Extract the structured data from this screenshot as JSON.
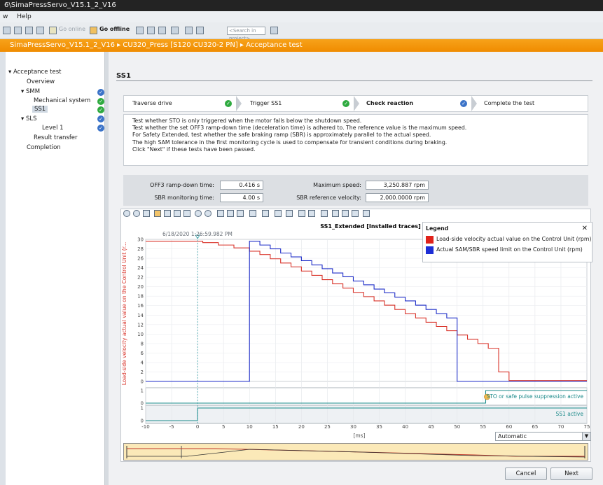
{
  "window": {
    "title": "6\\SimaPressServo_V15.1_2_V16"
  },
  "menu": {
    "items": [
      "w",
      "Help"
    ]
  },
  "toolbar": {
    "go_online": "Go online",
    "go_offline": "Go offline",
    "search_placeholder": "<Search in project>"
  },
  "breadcrumb": {
    "text": "SimaPressServo_V15.1_2_V16 ▸ CU320_Press [S120 CU320-2 PN] ▸ Acceptance test"
  },
  "tree": {
    "items": [
      {
        "label": "▾ Acceptance test",
        "check": ""
      },
      {
        "label": "Overview",
        "check": ""
      },
      {
        "label": "▾ SMM",
        "check": "blue"
      },
      {
        "label": "Mechanical system",
        "check": "green"
      },
      {
        "label": "SS1",
        "check": "green",
        "selected": true
      },
      {
        "label": "▾ SLS",
        "check": "blue"
      },
      {
        "label": "Level 1",
        "check": "blue"
      },
      {
        "label": "Result transfer",
        "check": ""
      },
      {
        "label": "Completion",
        "check": ""
      }
    ]
  },
  "page": {
    "title": "SS1"
  },
  "steps": [
    {
      "label": "Traverse drive",
      "status": "done"
    },
    {
      "label": "Trigger SS1",
      "status": "done"
    },
    {
      "label": "Check reaction",
      "status": "current"
    },
    {
      "label": "Complete the test",
      "status": ""
    }
  ],
  "description": [
    "Test whether STO is only triggered when the motor falls below the shutdown speed.",
    "Test whether the set OFF3 ramp-down time (deceleration time) is adhered to. The reference value is the maximum speed.",
    "For Safety Extended, test whether the safe braking ramp (SBR) is approximately parallel to the actual speed.",
    "The high SAM tolerance in the first monitoring cycle is used to compensate for transient conditions during braking.",
    "Click \"Next\" if these tests have been passed."
  ],
  "params": {
    "off3_label": "OFF3 ramp-down time:",
    "off3_value": "0.416 s",
    "sbr_mon_label": "SBR monitoring time:",
    "sbr_mon_value": "4.00 s",
    "max_speed_label": "Maximum speed:",
    "max_speed_value": "3,250.887 rpm",
    "sbr_ref_label": "SBR reference velocity:",
    "sbr_ref_value": "2,000.0000 rpm"
  },
  "chart": {
    "title": "SS1_Extended [Installed traces]",
    "cursor_time": "6/18/2020 1:26:59.982 PM",
    "ylabel": "Load-side velocity actual value on the Control Unit (r...",
    "xlabel": "[ms]",
    "sto_label": "STO or safe pulse suppression active",
    "ss1_label": "SS1 active",
    "scale_mode": "Automatic",
    "legend_title": "Legend",
    "legend_close": "✕"
  },
  "chart_data": {
    "type": "line",
    "title": "SS1_Extended [Installed traces]",
    "xlabel": "[ms]",
    "ylabel": "Load-side velocity actual value on the Control Unit (r...",
    "xlim": [
      -10,
      75
    ],
    "ylim": [
      0,
      30
    ],
    "x_ticks": [
      -10,
      -5,
      0,
      5,
      10,
      15,
      20,
      25,
      30,
      35,
      40,
      45,
      50,
      55,
      60,
      65,
      70,
      75
    ],
    "y_ticks": [
      0,
      2,
      4,
      6,
      8,
      10,
      12,
      14,
      16,
      18,
      20,
      22,
      24,
      26,
      28,
      30
    ],
    "series": [
      {
        "name": "Load-side velocity actual value on the Control Unit (rpm)",
        "color": "#d9342b",
        "x": [
          -10,
          1,
          1,
          4,
          4,
          7,
          7,
          10,
          10,
          12,
          12,
          14,
          14,
          16,
          16,
          18,
          18,
          20,
          20,
          22,
          22,
          24,
          24,
          26,
          26,
          28,
          28,
          30,
          30,
          32,
          32,
          34,
          34,
          36,
          36,
          38,
          38,
          40,
          40,
          42,
          42,
          44,
          44,
          46,
          46,
          48,
          48,
          50,
          50,
          52,
          52,
          54,
          54,
          56,
          56,
          58,
          58,
          60,
          60,
          75
        ],
        "y": [
          29.6,
          29.6,
          29.3,
          29.3,
          28.8,
          28.8,
          28.2,
          28.2,
          27.5,
          27.5,
          26.8,
          26.8,
          25.9,
          25.9,
          25.0,
          25.0,
          24.2,
          24.2,
          23.3,
          23.3,
          22.4,
          22.4,
          21.5,
          21.5,
          20.6,
          20.6,
          19.7,
          19.7,
          18.8,
          18.8,
          17.9,
          17.9,
          17.0,
          17.0,
          16.1,
          16.1,
          15.2,
          15.2,
          14.3,
          14.3,
          13.4,
          13.4,
          12.5,
          12.5,
          11.6,
          11.6,
          10.7,
          10.7,
          9.8,
          9.8,
          8.9,
          8.9,
          8.0,
          8.0,
          7.0,
          7.0,
          2.0,
          2.0,
          0.2,
          0.2
        ]
      },
      {
        "name": "Actual SAM/SBR speed limit on the Control Unit (rpm)",
        "color": "#1f2ec8",
        "x": [
          -10,
          10,
          10,
          12,
          12,
          14,
          14,
          16,
          16,
          18,
          18,
          20,
          20,
          22,
          22,
          24,
          24,
          26,
          26,
          28,
          28,
          30,
          30,
          32,
          32,
          34,
          34,
          36,
          36,
          38,
          38,
          40,
          40,
          42,
          42,
          44,
          44,
          46,
          46,
          48,
          48,
          50,
          50,
          75
        ],
        "y": [
          0,
          0,
          29.6,
          29.6,
          28.8,
          28.8,
          28.0,
          28.0,
          27.1,
          27.1,
          26.3,
          26.3,
          25.5,
          25.5,
          24.6,
          24.6,
          23.8,
          23.8,
          22.9,
          22.9,
          22.1,
          22.1,
          21.2,
          21.2,
          20.4,
          20.4,
          19.5,
          19.5,
          18.7,
          18.7,
          17.8,
          17.8,
          17.0,
          17.0,
          16.1,
          16.1,
          15.2,
          15.2,
          14.3,
          14.3,
          13.4,
          13.4,
          0,
          0
        ]
      }
    ],
    "digital": [
      {
        "name": "STO or safe pulse suppression active",
        "color": "#1b8a8a",
        "x": [
          -10,
          55.5,
          55.5,
          75
        ],
        "y": [
          0,
          0,
          1,
          1
        ]
      },
      {
        "name": "SS1 active",
        "color": "#1b8a8a",
        "x": [
          -10,
          0,
          0,
          75
        ],
        "y": [
          0,
          0,
          1,
          1
        ]
      }
    ],
    "cursor_x": 0,
    "digital_yticks": [
      0,
      1
    ]
  },
  "buttons": {
    "cancel": "Cancel",
    "next": "Next"
  },
  "colors": {
    "accent": "#f39200",
    "done": "#2eaa3f",
    "current": "#3b73c8"
  }
}
